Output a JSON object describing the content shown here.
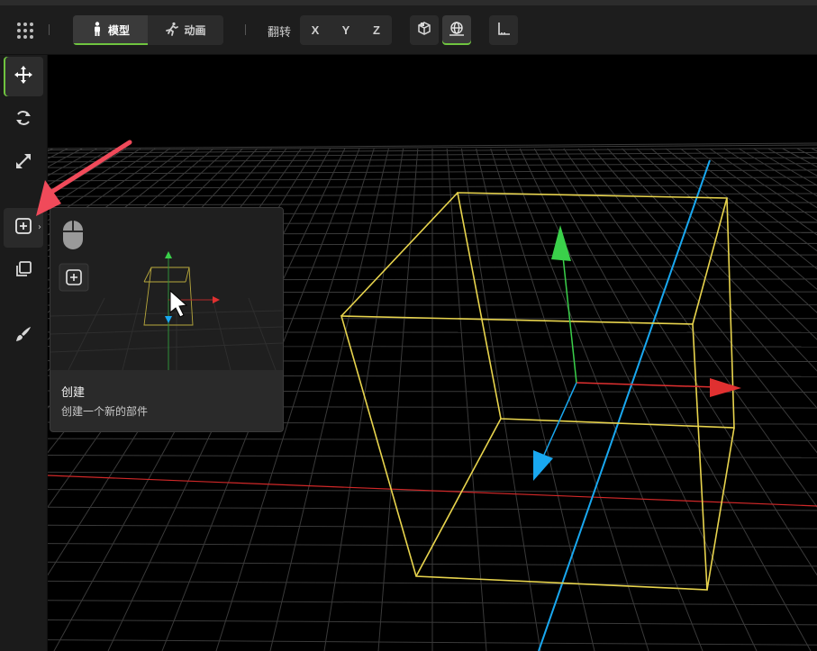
{
  "toolbar": {
    "menu_icon": "grid-dots-icon",
    "mode_tabs": [
      {
        "label": "模型",
        "icon": "person-standing-icon",
        "active": true
      },
      {
        "label": "动画",
        "icon": "person-running-icon",
        "active": false
      }
    ],
    "flip_label": "翻转",
    "flip_axes": [
      "X",
      "Y",
      "Z"
    ],
    "view_buttons": [
      {
        "icon": "cube-view-icon",
        "active": false
      },
      {
        "icon": "globe-grid-icon",
        "active": true
      },
      {
        "icon": "axis-corner-icon",
        "active": false
      }
    ]
  },
  "sidebar": {
    "tools": [
      {
        "name": "move",
        "icon": "move-arrows-icon",
        "active": true
      },
      {
        "name": "rotate",
        "icon": "rotate-icon",
        "active": false
      },
      {
        "name": "scale",
        "icon": "scale-diagonal-icon",
        "active": false
      },
      {
        "name": "create",
        "icon": "plus-square-icon",
        "active": false,
        "hovered": true
      },
      {
        "name": "duplicate",
        "icon": "copy-icon",
        "active": false
      },
      {
        "name": "paint",
        "icon": "brush-icon",
        "active": false
      }
    ]
  },
  "tooltip": {
    "title": "创建",
    "description": "创建一个新的部件",
    "preview_icons": [
      "mouse-icon",
      "plus-square-icon",
      "cursor-icon"
    ]
  },
  "colors": {
    "accent": "#6fc43f",
    "bounding_box": "#e8d44d",
    "axis_x": "#e03030",
    "axis_y": "#3ad04a",
    "axis_z": "#19a8f0",
    "annotation_arrow": "#f04a5a"
  }
}
